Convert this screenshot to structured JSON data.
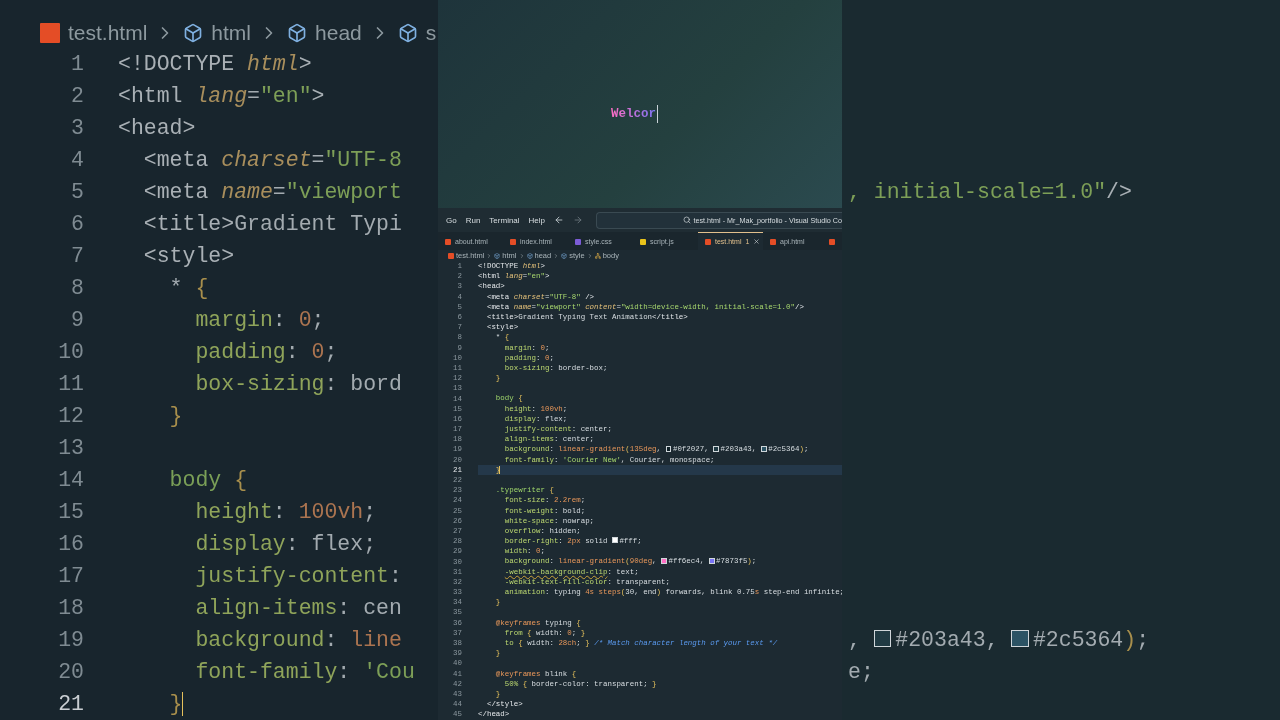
{
  "backdrop": {
    "breadcrumb": [
      {
        "label": "test.html",
        "kind": "file"
      },
      {
        "label": "html",
        "kind": "element"
      },
      {
        "label": "head",
        "kind": "element"
      },
      {
        "label": "s",
        "kind": "element"
      }
    ],
    "lines": [
      {
        "n": "1",
        "current": false,
        "tokens": [
          {
            "text": "<!DOCTYPE ",
            "kind": "tag"
          },
          {
            "text": "html",
            "kind": "attr"
          },
          {
            "text": ">",
            "kind": "tag"
          }
        ]
      },
      {
        "n": "2",
        "current": false,
        "tokens": [
          {
            "text": "<html ",
            "kind": "tag"
          },
          {
            "text": "lang",
            "kind": "attr"
          },
          {
            "text": "=",
            "kind": "plain"
          },
          {
            "text": "\"en\"",
            "kind": "str"
          },
          {
            "text": ">",
            "kind": "tag"
          }
        ]
      },
      {
        "n": "3",
        "current": false,
        "tokens": [
          {
            "text": "<head>",
            "kind": "tag"
          }
        ]
      },
      {
        "n": "4",
        "current": false,
        "tokens": [
          {
            "text": "  <meta ",
            "kind": "tag"
          },
          {
            "text": "charset",
            "kind": "attr"
          },
          {
            "text": "=",
            "kind": "plain"
          },
          {
            "text": "\"UTF-8",
            "kind": "str"
          }
        ]
      },
      {
        "n": "5",
        "current": false,
        "tokens": [
          {
            "text": "  <meta ",
            "kind": "tag"
          },
          {
            "text": "name",
            "kind": "attr"
          },
          {
            "text": "=",
            "kind": "plain"
          },
          {
            "text": "\"viewport",
            "kind": "str"
          }
        ],
        "tail": [
          {
            "text": ", initial-scale=1.0\"",
            "kind": "str"
          },
          {
            "text": "/>",
            "kind": "tag"
          }
        ]
      },
      {
        "n": "6",
        "current": false,
        "tokens": [
          {
            "text": "  <title>",
            "kind": "tag"
          },
          {
            "text": "Gradient Typi",
            "kind": "plain"
          }
        ]
      },
      {
        "n": "7",
        "current": false,
        "tokens": [
          {
            "text": "  <style>",
            "kind": "tag"
          }
        ]
      },
      {
        "n": "8",
        "current": false,
        "tokens": [
          {
            "text": "    * ",
            "kind": "plain"
          },
          {
            "text": "{",
            "kind": "brace"
          }
        ]
      },
      {
        "n": "9",
        "current": false,
        "tokens": [
          {
            "text": "      margin",
            "kind": "prop"
          },
          {
            "text": ": ",
            "kind": "plain"
          },
          {
            "text": "0",
            "kind": "num"
          },
          {
            "text": ";",
            "kind": "plain"
          }
        ]
      },
      {
        "n": "10",
        "current": false,
        "tokens": [
          {
            "text": "      padding",
            "kind": "prop"
          },
          {
            "text": ": ",
            "kind": "plain"
          },
          {
            "text": "0",
            "kind": "num"
          },
          {
            "text": ";",
            "kind": "plain"
          }
        ]
      },
      {
        "n": "11",
        "current": false,
        "tokens": [
          {
            "text": "      box-sizing",
            "kind": "prop"
          },
          {
            "text": ": bord",
            "kind": "plain"
          }
        ]
      },
      {
        "n": "12",
        "current": false,
        "tokens": [
          {
            "text": "    }",
            "kind": "brace"
          }
        ]
      },
      {
        "n": "13",
        "current": false
      },
      {
        "n": "14",
        "current": false,
        "tokens": [
          {
            "text": "    body",
            "kind": "sel"
          },
          {
            "text": " {",
            "kind": "brace"
          }
        ]
      },
      {
        "n": "15",
        "current": false,
        "tokens": [
          {
            "text": "      height",
            "kind": "prop"
          },
          {
            "text": ": ",
            "kind": "plain"
          },
          {
            "text": "100",
            "kind": "num"
          },
          {
            "text": "vh",
            "kind": "kw"
          },
          {
            "text": ";",
            "kind": "plain"
          }
        ]
      },
      {
        "n": "16",
        "current": false,
        "tokens": [
          {
            "text": "      display",
            "kind": "prop"
          },
          {
            "text": ": flex;",
            "kind": "plain"
          }
        ]
      },
      {
        "n": "17",
        "current": false,
        "tokens": [
          {
            "text": "      justify-content",
            "kind": "prop"
          },
          {
            "text": ":",
            "kind": "plain"
          }
        ]
      },
      {
        "n": "18",
        "current": false,
        "tokens": [
          {
            "text": "      align-items",
            "kind": "prop"
          },
          {
            "text": ": cen",
            "kind": "plain"
          }
        ]
      },
      {
        "n": "19",
        "current": false,
        "tokens": [
          {
            "text": "      background",
            "kind": "prop"
          },
          {
            "text": ": ",
            "kind": "plain"
          },
          {
            "text": "line",
            "kind": "fn"
          }
        ],
        "tail": [
          {
            "text": ", ",
            "kind": "plain"
          },
          {
            "text": "#203a43",
            "kind": "swatch"
          },
          {
            "text": ", ",
            "kind": "plain"
          },
          {
            "text": "#2c5364",
            "kind": "swatch"
          },
          {
            "text": ")",
            "kind": "brace"
          },
          {
            "text": ";",
            "kind": "plain"
          }
        ]
      },
      {
        "n": "20",
        "current": false,
        "tokens": [
          {
            "text": "      font-family",
            "kind": "prop"
          },
          {
            "text": ": ",
            "kind": "plain"
          },
          {
            "text": "'Cou",
            "kind": "str"
          }
        ],
        "tail": [
          {
            "text": "e;",
            "kind": "plain"
          }
        ]
      },
      {
        "n": "21",
        "current": true,
        "tokens": [
          {
            "text": "    }",
            "kind": "brace"
          }
        ]
      }
    ]
  },
  "preview": {
    "typed_text": "Welcor"
  },
  "menu": [
    "Go",
    "Run",
    "Terminal",
    "Help"
  ],
  "command_center": {
    "title": "test.html - Mr_Mak_portfolio - Visual Studio Co"
  },
  "tabs": [
    {
      "label": "about.html",
      "kind": "html",
      "selected": false
    },
    {
      "label": "index.html",
      "kind": "html",
      "selected": false
    },
    {
      "label": "style.css",
      "kind": "css",
      "selected": false
    },
    {
      "label": "script.js",
      "kind": "js",
      "selected": false
    },
    {
      "label": "test.html",
      "kind": "html",
      "selected": true,
      "badge": "1"
    },
    {
      "label": "api.html",
      "kind": "html",
      "selected": false
    },
    {
      "kind": "html",
      "selected": false
    }
  ],
  "breadcrumb": [
    {
      "label": "test.html",
      "kind": "file"
    },
    {
      "label": "html",
      "kind": "element"
    },
    {
      "label": "head",
      "kind": "element"
    },
    {
      "label": "style",
      "kind": "element"
    },
    {
      "label": "body",
      "kind": "tree"
    }
  ],
  "editor": {
    "lines": [
      {
        "n": "1",
        "current": false,
        "tokens": [
          {
            "text": "<!DOCTYPE ",
            "kind": "tag"
          },
          {
            "text": "html",
            "kind": "attr"
          },
          {
            "text": ">",
            "kind": "tag"
          }
        ]
      },
      {
        "n": "2",
        "current": false,
        "tokens": [
          {
            "text": "<html ",
            "kind": "tag"
          },
          {
            "text": "lang",
            "kind": "attr"
          },
          {
            "text": "=",
            "kind": "plain"
          },
          {
            "text": "\"en\"",
            "kind": "str"
          },
          {
            "text": ">",
            "kind": "tag"
          }
        ]
      },
      {
        "n": "3",
        "current": false,
        "tokens": [
          {
            "text": "<head>",
            "kind": "tag"
          }
        ]
      },
      {
        "n": "4",
        "current": false,
        "tokens": [
          {
            "text": "  <meta ",
            "kind": "tag"
          },
          {
            "text": "charset",
            "kind": "attr"
          },
          {
            "text": "=",
            "kind": "plain"
          },
          {
            "text": "\"UTF-8\"",
            "kind": "str"
          },
          {
            "text": " />",
            "kind": "tag"
          }
        ]
      },
      {
        "n": "5",
        "current": false,
        "tokens": [
          {
            "text": "  <meta ",
            "kind": "tag"
          },
          {
            "text": "name",
            "kind": "attr"
          },
          {
            "text": "=",
            "kind": "plain"
          },
          {
            "text": "\"viewport\" ",
            "kind": "str"
          },
          {
            "text": "content",
            "kind": "attr"
          },
          {
            "text": "=",
            "kind": "plain"
          },
          {
            "text": "\"width=device-width, initial-scale=1.0\"",
            "kind": "str"
          },
          {
            "text": "/>",
            "kind": "tag"
          }
        ]
      },
      {
        "n": "6",
        "current": false,
        "tokens": [
          {
            "text": "  <title>",
            "kind": "tag"
          },
          {
            "text": "Gradient Typing Text Animation",
            "kind": "plain"
          },
          {
            "text": "</title>",
            "kind": "tag"
          }
        ]
      },
      {
        "n": "7",
        "current": false,
        "tokens": [
          {
            "text": "  <style>",
            "kind": "tag"
          }
        ]
      },
      {
        "n": "8",
        "current": false,
        "tokens": [
          {
            "text": "    * ",
            "kind": "plain"
          },
          {
            "text": "{",
            "kind": "brace"
          }
        ]
      },
      {
        "n": "9",
        "current": false,
        "tokens": [
          {
            "text": "      margin",
            "kind": "prop"
          },
          {
            "text": ": ",
            "kind": "plain"
          },
          {
            "text": "0",
            "kind": "num"
          },
          {
            "text": ";",
            "kind": "plain"
          }
        ]
      },
      {
        "n": "10",
        "current": false,
        "tokens": [
          {
            "text": "      padding",
            "kind": "prop"
          },
          {
            "text": ": ",
            "kind": "plain"
          },
          {
            "text": "0",
            "kind": "num"
          },
          {
            "text": ";",
            "kind": "plain"
          }
        ]
      },
      {
        "n": "11",
        "current": false,
        "tokens": [
          {
            "text": "      box-sizing",
            "kind": "prop"
          },
          {
            "text": ": border-box;",
            "kind": "plain"
          }
        ]
      },
      {
        "n": "12",
        "current": false,
        "tokens": [
          {
            "text": "    }",
            "kind": "brace"
          }
        ]
      },
      {
        "n": "13",
        "current": false
      },
      {
        "n": "14",
        "current": false,
        "tokens": [
          {
            "text": "    body",
            "kind": "sel"
          },
          {
            "text": " {",
            "kind": "brace"
          }
        ]
      },
      {
        "n": "15",
        "current": false,
        "tokens": [
          {
            "text": "      height",
            "kind": "prop"
          },
          {
            "text": ": ",
            "kind": "plain"
          },
          {
            "text": "100",
            "kind": "num"
          },
          {
            "text": "vh",
            "kind": "kw"
          },
          {
            "text": ";",
            "kind": "plain"
          }
        ]
      },
      {
        "n": "16",
        "current": false,
        "tokens": [
          {
            "text": "      display",
            "kind": "prop"
          },
          {
            "text": ": flex;",
            "kind": "plain"
          }
        ]
      },
      {
        "n": "17",
        "current": false,
        "tokens": [
          {
            "text": "      justify-content",
            "kind": "prop"
          },
          {
            "text": ": center;",
            "kind": "plain"
          }
        ]
      },
      {
        "n": "18",
        "current": false,
        "tokens": [
          {
            "text": "      align-items",
            "kind": "prop"
          },
          {
            "text": ": center;",
            "kind": "plain"
          }
        ]
      },
      {
        "n": "19",
        "current": false,
        "tokens": [
          {
            "text": "      background",
            "kind": "prop"
          },
          {
            "text": ": ",
            "kind": "plain"
          },
          {
            "text": "linear-gradient",
            "kind": "fn"
          },
          {
            "text": "(",
            "kind": "brace"
          },
          {
            "text": "135deg",
            "kind": "num"
          },
          {
            "text": ", ",
            "kind": "plain"
          },
          {
            "text": "#0f2027",
            "kind": "swatch"
          },
          {
            "text": ", ",
            "kind": "plain"
          },
          {
            "text": "#203a43",
            "kind": "swatch"
          },
          {
            "text": ", ",
            "kind": "plain"
          },
          {
            "text": "#2c5364",
            "kind": "swatch"
          },
          {
            "text": ")",
            "kind": "brace"
          },
          {
            "text": ";",
            "kind": "plain"
          }
        ]
      },
      {
        "n": "20",
        "current": false,
        "tokens": [
          {
            "text": "      font-family",
            "kind": "prop"
          },
          {
            "text": ": ",
            "kind": "plain"
          },
          {
            "text": "'Courier New'",
            "kind": "str"
          },
          {
            "text": ", Courier, monospace;",
            "kind": "plain"
          }
        ]
      },
      {
        "n": "21",
        "current": true,
        "tokens": [
          {
            "text": "    }",
            "kind": "brace"
          }
        ]
      },
      {
        "n": "22",
        "current": false
      },
      {
        "n": "23",
        "current": false,
        "tokens": [
          {
            "text": "    .typewriter",
            "kind": "sel"
          },
          {
            "text": " {",
            "kind": "brace"
          }
        ]
      },
      {
        "n": "24",
        "current": false,
        "tokens": [
          {
            "text": "      font-size",
            "kind": "prop"
          },
          {
            "text": ": ",
            "kind": "plain"
          },
          {
            "text": "2.2",
            "kind": "num"
          },
          {
            "text": "rem",
            "kind": "kw"
          },
          {
            "text": ";",
            "kind": "plain"
          }
        ]
      },
      {
        "n": "25",
        "current": false,
        "tokens": [
          {
            "text": "      font-weight",
            "kind": "prop"
          },
          {
            "text": ": bold;",
            "kind": "plain"
          }
        ]
      },
      {
        "n": "26",
        "current": false,
        "tokens": [
          {
            "text": "      white-space",
            "kind": "prop"
          },
          {
            "text": ": nowrap;",
            "kind": "plain"
          }
        ]
      },
      {
        "n": "27",
        "current": false,
        "tokens": [
          {
            "text": "      overflow",
            "kind": "prop"
          },
          {
            "text": ": hidden;",
            "kind": "plain"
          }
        ]
      },
      {
        "n": "28",
        "current": false,
        "tokens": [
          {
            "text": "      border-right",
            "kind": "prop"
          },
          {
            "text": ": ",
            "kind": "plain"
          },
          {
            "text": "2",
            "kind": "num"
          },
          {
            "text": "px",
            "kind": "kw"
          },
          {
            "text": " solid ",
            "kind": "plain"
          },
          {
            "text": "#fff;",
            "kind": "swatch"
          }
        ]
      },
      {
        "n": "29",
        "current": false,
        "tokens": [
          {
            "text": "      width",
            "kind": "prop"
          },
          {
            "text": ": ",
            "kind": "plain"
          },
          {
            "text": "0",
            "kind": "num"
          },
          {
            "text": ";",
            "kind": "plain"
          }
        ]
      },
      {
        "n": "30",
        "current": false,
        "tokens": [
          {
            "text": "      background",
            "kind": "prop"
          },
          {
            "text": ": ",
            "kind": "plain"
          },
          {
            "text": "linear-gradient",
            "kind": "fn"
          },
          {
            "text": "(",
            "kind": "brace"
          },
          {
            "text": "90deg",
            "kind": "num"
          },
          {
            "text": ", ",
            "kind": "plain"
          },
          {
            "text": "#ff6ec4",
            "kind": "swatch"
          },
          {
            "text": ", ",
            "kind": "plain"
          },
          {
            "text": "#7873f5",
            "kind": "swatch"
          },
          {
            "text": ")",
            "kind": "brace"
          },
          {
            "text": ";",
            "kind": "plain"
          }
        ]
      },
      {
        "n": "31",
        "current": false,
        "tokens": [
          {
            "text": "      -webkit-background-clip",
            "kind": "warn"
          },
          {
            "text": ": text;",
            "kind": "plain"
          }
        ]
      },
      {
        "n": "32",
        "current": false,
        "tokens": [
          {
            "text": "      -webkit-text-fill-color",
            "kind": "prop"
          },
          {
            "text": ": transparent;",
            "kind": "plain"
          }
        ]
      },
      {
        "n": "33",
        "current": false,
        "tokens": [
          {
            "text": "      animation",
            "kind": "prop"
          },
          {
            "text": ": typing ",
            "kind": "plain"
          },
          {
            "text": "4",
            "kind": "num"
          },
          {
            "text": "s ",
            "kind": "kw"
          },
          {
            "text": "steps",
            "kind": "fn"
          },
          {
            "text": "(",
            "kind": "brace"
          },
          {
            "text": "30, end",
            "kind": "plain"
          },
          {
            "text": ")",
            "kind": "brace"
          },
          {
            "text": " forwards, blink 0.75",
            "kind": "plain"
          },
          {
            "text": "s",
            "kind": "kw"
          },
          {
            "text": " step-end infinite;",
            "kind": "plain"
          }
        ]
      },
      {
        "n": "34",
        "current": false,
        "tokens": [
          {
            "text": "    }",
            "kind": "brace"
          }
        ]
      },
      {
        "n": "35",
        "current": false
      },
      {
        "n": "36",
        "current": false,
        "tokens": [
          {
            "text": "    @keyframes",
            "kind": "kw"
          },
          {
            "text": " typing ",
            "kind": "plain"
          },
          {
            "text": "{",
            "kind": "brace"
          }
        ]
      },
      {
        "n": "37",
        "current": false,
        "tokens": [
          {
            "text": "      from",
            "kind": "prop"
          },
          {
            "text": " { ",
            "kind": "brace"
          },
          {
            "text": "width: ",
            "kind": "plain"
          },
          {
            "text": "0",
            "kind": "num"
          },
          {
            "text": "; ",
            "kind": "plain"
          },
          {
            "text": "}",
            "kind": "brace"
          }
        ]
      },
      {
        "n": "38",
        "current": false,
        "tokens": [
          {
            "text": "      to",
            "kind": "prop"
          },
          {
            "text": " { ",
            "kind": "brace"
          },
          {
            "text": "width: ",
            "kind": "plain"
          },
          {
            "text": "28",
            "kind": "num"
          },
          {
            "text": "ch",
            "kind": "kw"
          },
          {
            "text": "; ",
            "kind": "plain"
          },
          {
            "text": "} ",
            "kind": "brace"
          },
          {
            "text": "/* Match character length of your text */",
            "kind": "comment"
          }
        ]
      },
      {
        "n": "39",
        "current": false,
        "tokens": [
          {
            "text": "    }",
            "kind": "brace"
          }
        ]
      },
      {
        "n": "40",
        "current": false
      },
      {
        "n": "41",
        "current": false,
        "tokens": [
          {
            "text": "    @keyframes",
            "kind": "kw"
          },
          {
            "text": " blink ",
            "kind": "plain"
          },
          {
            "text": "{",
            "kind": "brace"
          }
        ]
      },
      {
        "n": "42",
        "current": false,
        "tokens": [
          {
            "text": "      50%",
            "kind": "prop"
          },
          {
            "text": " { ",
            "kind": "brace"
          },
          {
            "text": "border-color: transparent; ",
            "kind": "plain"
          },
          {
            "text": "}",
            "kind": "brace"
          }
        ]
      },
      {
        "n": "43",
        "current": false,
        "tokens": [
          {
            "text": "    }",
            "kind": "brace"
          }
        ]
      },
      {
        "n": "44",
        "current": false,
        "tokens": [
          {
            "text": "  </style>",
            "kind": "tag"
          }
        ]
      },
      {
        "n": "45",
        "current": false,
        "tokens": [
          {
            "text": "</head>",
            "kind": "tag"
          }
        ]
      }
    ]
  }
}
